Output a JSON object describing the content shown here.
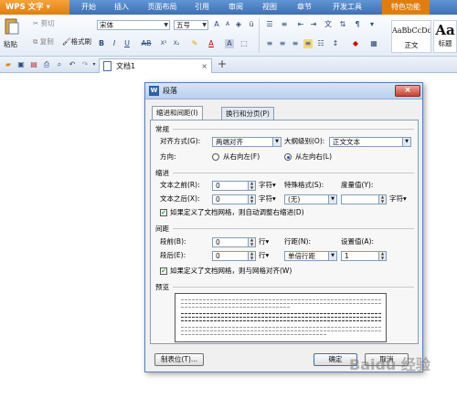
{
  "app": {
    "name": "WPS 文字",
    "dropdown": "▾"
  },
  "menus": [
    "开始",
    "插入",
    "页面布局",
    "引用",
    "审阅",
    "视图",
    "章节",
    "开发工具",
    "特色功能"
  ],
  "ribbon": {
    "paste": "粘贴",
    "cut": "剪切",
    "copy": "复制",
    "format_painter": "格式刷",
    "font_name": "宋体",
    "font_size": "五号",
    "style_normal_sample": "AaBbCcDd",
    "style_normal_label": "正文",
    "style_heading_sample": "Aa",
    "style_heading_label": "标题"
  },
  "doc_tab": {
    "title": "文档1",
    "close": "×",
    "new_tab": "+"
  },
  "dialog": {
    "title": "段落",
    "close": "×",
    "tabs": [
      "缩进和间距(I)",
      "换行和分页(P)"
    ],
    "general": {
      "section": "常规",
      "alignment_label": "对齐方式(G):",
      "alignment_value": "两端对齐",
      "outline_label": "大纲级别(O):",
      "outline_value": "正文文本",
      "direction_label": "方向:",
      "rtl_label": "从右向左(F)",
      "ltr_label": "从左向右(L)"
    },
    "indent": {
      "section": "缩进",
      "before_label": "文本之前(R):",
      "before_value": "0",
      "before_unit": "字符▾",
      "after_label": "文本之后(X):",
      "after_value": "0",
      "after_unit": "字符▾",
      "special_label": "特殊格式(S):",
      "special_value": "(无)",
      "measure_label": "度量值(Y):",
      "measure_unit": "字符▾",
      "grid_checkbox": "如果定义了文档网格，则自动调整右缩进(D)"
    },
    "spacing": {
      "section": "间距",
      "before_label": "段前(B):",
      "before_value": "0",
      "before_unit": "行▾",
      "after_label": "段后(E):",
      "after_value": "0",
      "after_unit": "行▾",
      "line_label": "行距(N):",
      "line_value": "单倍行距",
      "setting_label": "设置值(A):",
      "setting_value": "1",
      "grid_checkbox": "如果定义了文档网格，则与网格对齐(W)"
    },
    "preview_section": "预览",
    "buttons": {
      "tabs": "制表位(T)...",
      "ok": "确定",
      "cancel": "取消"
    }
  },
  "watermark": "Baidu 经验"
}
